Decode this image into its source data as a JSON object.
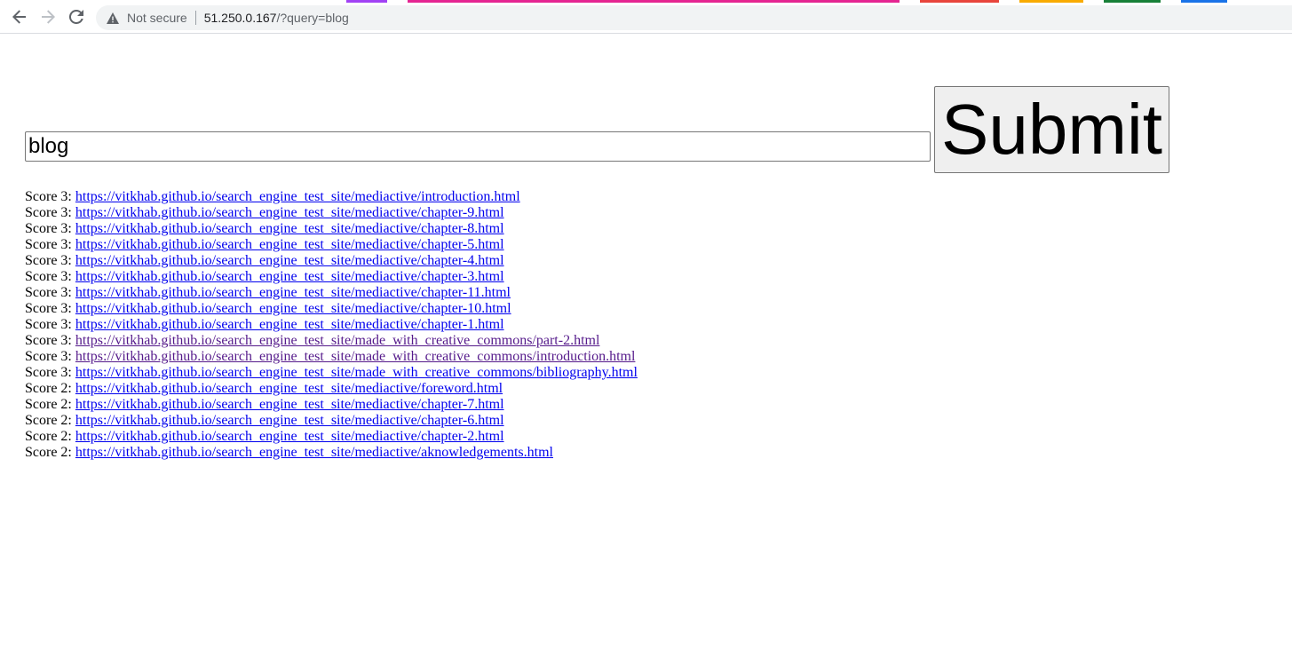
{
  "browser": {
    "not_secure_label": "Not secure",
    "url_host": "51.250.0.167",
    "url_path": "/?query=blog",
    "tab_strip_colors": [
      "#a142f4",
      "#e52592",
      "#e8453c",
      "#f9ab00",
      "#188038",
      "#1a73e8"
    ]
  },
  "search": {
    "query_value": "blog",
    "submit_label": "Submit"
  },
  "results": [
    {
      "score_label": "Score 3:",
      "url": "https://vitkhab.github.io/search_engine_test_site/mediactive/introduction.html",
      "visited": false
    },
    {
      "score_label": "Score 3:",
      "url": "https://vitkhab.github.io/search_engine_test_site/mediactive/chapter-9.html",
      "visited": false
    },
    {
      "score_label": "Score 3:",
      "url": "https://vitkhab.github.io/search_engine_test_site/mediactive/chapter-8.html",
      "visited": false
    },
    {
      "score_label": "Score 3:",
      "url": "https://vitkhab.github.io/search_engine_test_site/mediactive/chapter-5.html",
      "visited": false
    },
    {
      "score_label": "Score 3:",
      "url": "https://vitkhab.github.io/search_engine_test_site/mediactive/chapter-4.html",
      "visited": false
    },
    {
      "score_label": "Score 3:",
      "url": "https://vitkhab.github.io/search_engine_test_site/mediactive/chapter-3.html",
      "visited": false
    },
    {
      "score_label": "Score 3:",
      "url": "https://vitkhab.github.io/search_engine_test_site/mediactive/chapter-11.html",
      "visited": false
    },
    {
      "score_label": "Score 3:",
      "url": "https://vitkhab.github.io/search_engine_test_site/mediactive/chapter-10.html",
      "visited": false
    },
    {
      "score_label": "Score 3:",
      "url": "https://vitkhab.github.io/search_engine_test_site/mediactive/chapter-1.html",
      "visited": false
    },
    {
      "score_label": "Score 3:",
      "url": "https://vitkhab.github.io/search_engine_test_site/made_with_creative_commons/part-2.html",
      "visited": true
    },
    {
      "score_label": "Score 3:",
      "url": "https://vitkhab.github.io/search_engine_test_site/made_with_creative_commons/introduction.html",
      "visited": true
    },
    {
      "score_label": "Score 3:",
      "url": "https://vitkhab.github.io/search_engine_test_site/made_with_creative_commons/bibliography.html",
      "visited": false
    },
    {
      "score_label": "Score 2:",
      "url": "https://vitkhab.github.io/search_engine_test_site/mediactive/foreword.html",
      "visited": false
    },
    {
      "score_label": "Score 2:",
      "url": "https://vitkhab.github.io/search_engine_test_site/mediactive/chapter-7.html",
      "visited": false
    },
    {
      "score_label": "Score 2:",
      "url": "https://vitkhab.github.io/search_engine_test_site/mediactive/chapter-6.html",
      "visited": false
    },
    {
      "score_label": "Score 2:",
      "url": "https://vitkhab.github.io/search_engine_test_site/mediactive/chapter-2.html",
      "visited": false
    },
    {
      "score_label": "Score 2:",
      "url": "https://vitkhab.github.io/search_engine_test_site/mediactive/aknowledgements.html",
      "visited": false
    }
  ]
}
